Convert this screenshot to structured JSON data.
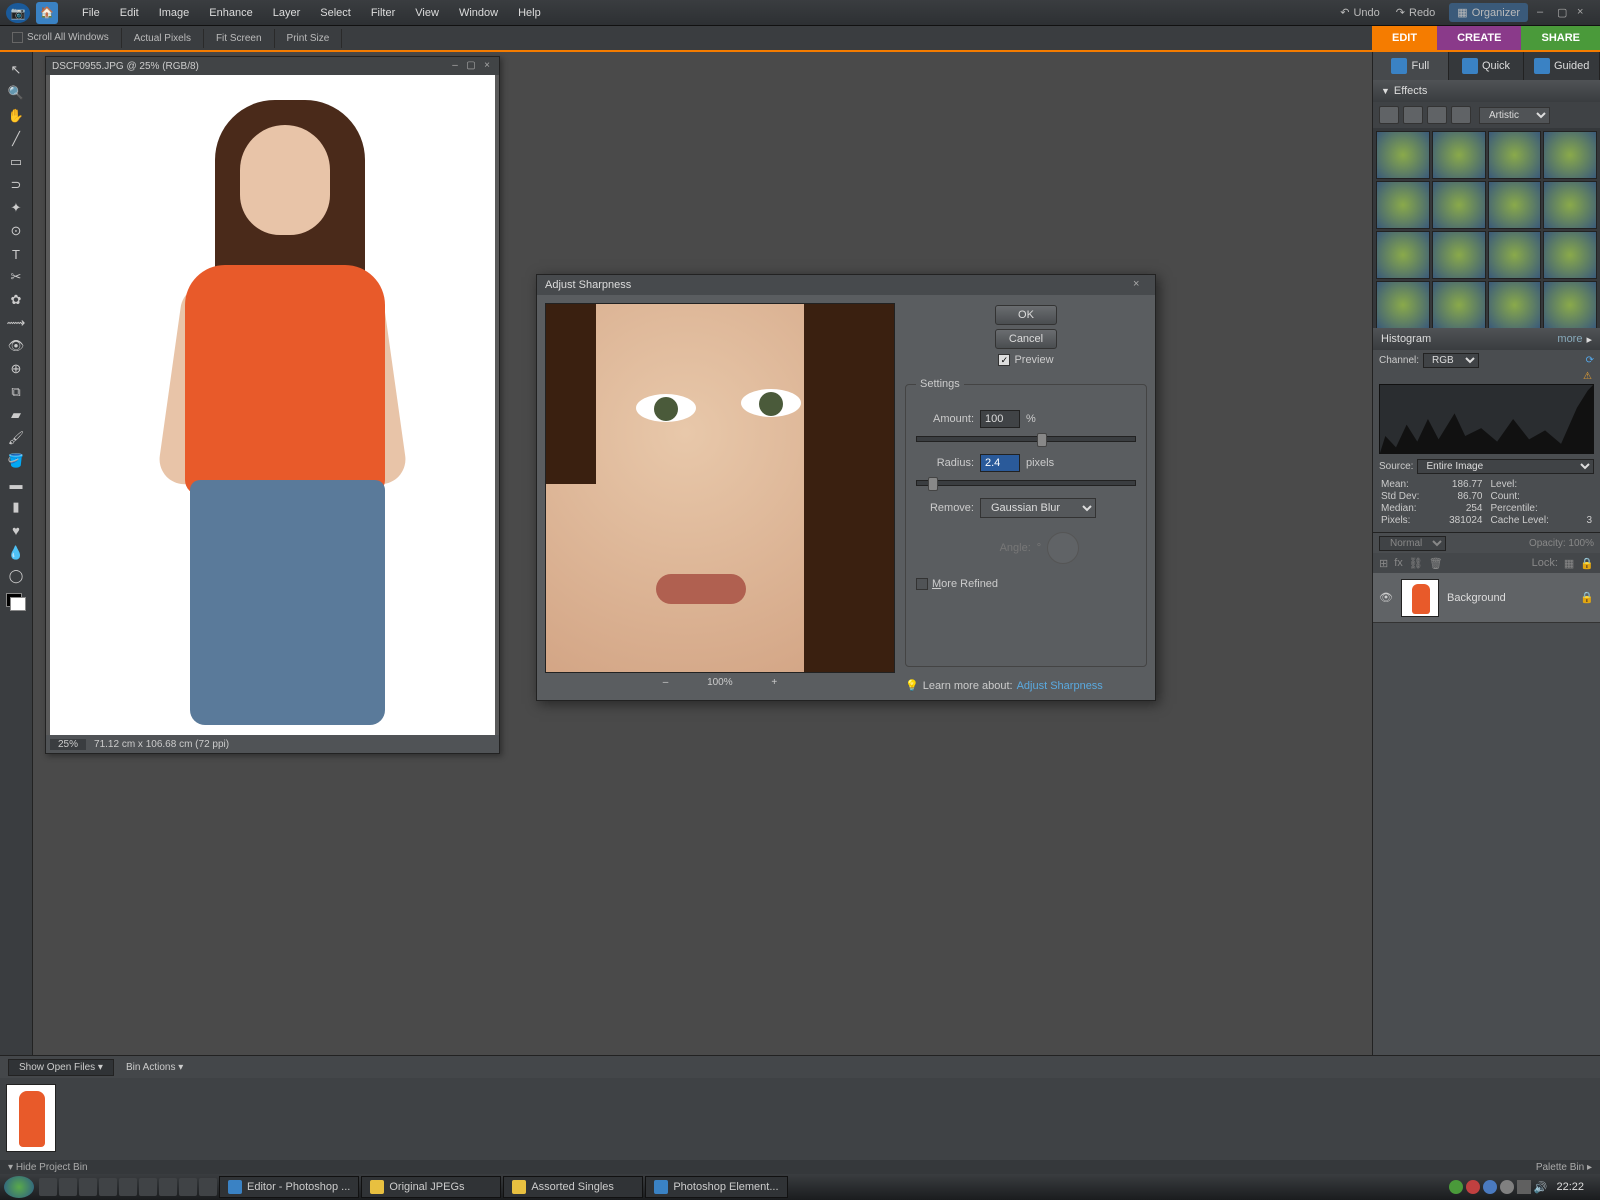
{
  "menubar": {
    "items": [
      "File",
      "Edit",
      "Image",
      "Enhance",
      "Layer",
      "Select",
      "Filter",
      "View",
      "Window",
      "Help"
    ],
    "undo": "Undo",
    "redo": "Redo",
    "organizer": "Organizer"
  },
  "optionsbar": {
    "scroll_all": "Scroll All Windows",
    "actual_pixels": "Actual Pixels",
    "fit_screen": "Fit Screen",
    "print_size": "Print Size"
  },
  "tabs": {
    "edit": "EDIT",
    "create": "CREATE",
    "share": "SHARE"
  },
  "mode_tabs": {
    "full": "Full",
    "quick": "Quick",
    "guided": "Guided"
  },
  "effects": {
    "title": "Effects",
    "category": "Artistic"
  },
  "document": {
    "title": "DSCF0955.JPG @ 25% (RGB/8)",
    "zoom": "25%",
    "dimensions": "71.12 cm x 106.68 cm (72 ppi)"
  },
  "dialog": {
    "title": "Adjust Sharpness",
    "ok": "OK",
    "cancel": "Cancel",
    "preview_label": "Preview",
    "preview_checked": true,
    "fieldset_label": "Settings",
    "amount_label": "Amount:",
    "amount_value": "100",
    "amount_unit": "%",
    "radius_label": "Radius:",
    "radius_value": "2.4",
    "radius_unit": "pixels",
    "remove_label": "Remove:",
    "remove_value": "Gaussian Blur",
    "angle_label": "Angle:",
    "angle_unit": "°",
    "more_refined": "More Refined",
    "learn_label": "Learn more about:",
    "learn_link": "Adjust Sharpness",
    "zoom_level": "100%"
  },
  "histogram": {
    "title": "Histogram",
    "more": "more",
    "channel_label": "Channel:",
    "channel_value": "RGB",
    "source_label": "Source:",
    "source_value": "Entire Image",
    "stats": {
      "mean_l": "Mean:",
      "mean_v": "186.77",
      "level_l": "Level:",
      "level_v": "",
      "std_l": "Std Dev:",
      "std_v": "86.70",
      "count_l": "Count:",
      "count_v": "",
      "median_l": "Median:",
      "median_v": "254",
      "pct_l": "Percentile:",
      "pct_v": "",
      "pixels_l": "Pixels:",
      "pixels_v": "381024",
      "cache_l": "Cache Level:",
      "cache_v": "3"
    }
  },
  "layers": {
    "blend": "Normal",
    "opacity_label": "Opacity:",
    "opacity_value": "100%",
    "lock_label": "Lock:",
    "layer0": "Background"
  },
  "projectbin": {
    "show_open": "Show Open Files",
    "bin_actions": "Bin Actions",
    "hide": "Hide Project Bin",
    "palette": "Palette Bin"
  },
  "taskbar": {
    "tasks": [
      "Editor - Photoshop ...",
      "Original JPEGs",
      "Assorted Singles",
      "Photoshop Element..."
    ],
    "clock": "22:22"
  }
}
